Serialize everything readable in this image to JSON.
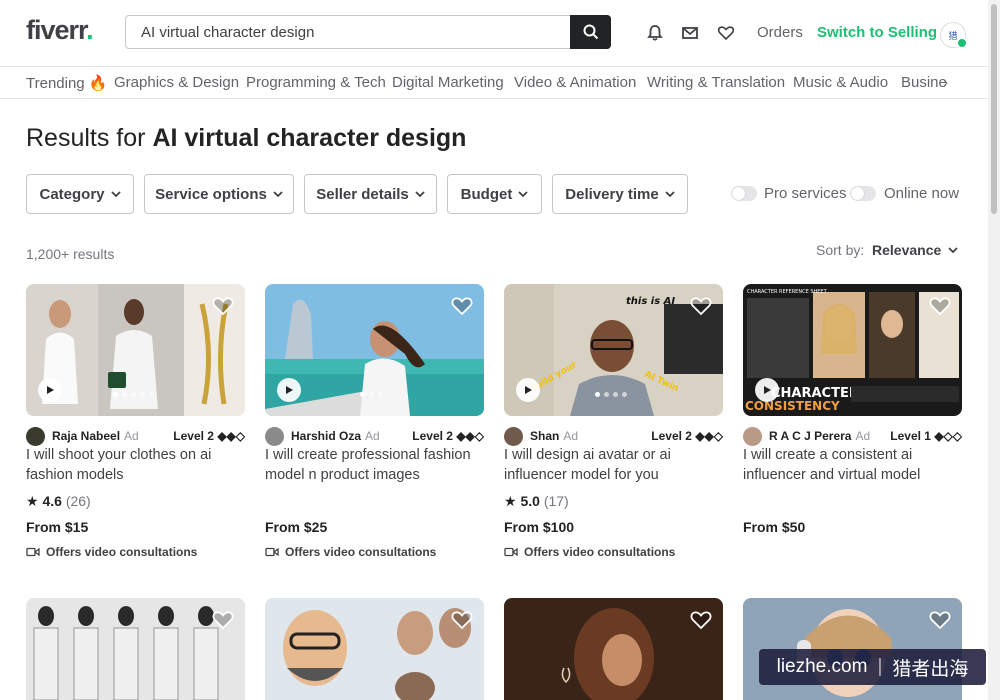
{
  "header": {
    "logo": "fiverr",
    "logo_dot": ".",
    "search_value": "AI virtual character design",
    "orders": "Orders",
    "switch_selling": "Switch to Selling",
    "avatar_text": "猎"
  },
  "categories": [
    "Trending",
    "Graphics & Design",
    "Programming & Tech",
    "Digital Marketing",
    "Video & Animation",
    "Writing & Translation",
    "Music & Audio",
    "Busine"
  ],
  "trending_emoji": "🔥",
  "results": {
    "title_prefix": "Results for ",
    "query": "AI virtual character design",
    "count": "1,200+ results",
    "sort_label": "Sort by:",
    "sort_value": "Relevance"
  },
  "filters": [
    "Category",
    "Service options",
    "Seller details",
    "Budget",
    "Delivery time"
  ],
  "toggles": [
    "Pro services",
    "Online now"
  ],
  "gigs": [
    {
      "seller": "Raja Nabeel",
      "ad": "Ad",
      "level": "Level 2",
      "level_diamonds": "◆◆◇",
      "title": "I will shoot your clothes on ai fashion models",
      "rating": "4.6",
      "reviews": "(26)",
      "price": "From $15",
      "video": "Offers video consultations"
    },
    {
      "seller": "Harshid Oza",
      "ad": "Ad",
      "level": "Level 2",
      "level_diamonds": "◆◆◇",
      "title": "I will create professional fashion model n product images",
      "rating": "",
      "reviews": "",
      "price": "From $25",
      "video": "Offers video consultations"
    },
    {
      "seller": "Shan",
      "ad": "Ad",
      "level": "Level 2",
      "level_diamonds": "◆◆◇",
      "title": "I will design ai avatar or ai influencer model for you",
      "rating": "5.0",
      "reviews": "(17)",
      "price": "From $100",
      "video": "Offers video consultations"
    },
    {
      "seller": "R A C J Perera",
      "ad": "Ad",
      "level": "Level 1",
      "level_diamonds": "◆◇◇",
      "title": "I will create a consistent ai influencer and virtual model",
      "rating": "",
      "reviews": "",
      "price": "From $50",
      "video": ""
    }
  ],
  "image_texts": {
    "card3_overlay": "this is AI",
    "card3_build": "Build your",
    "card3_twin": "AI Twin",
    "card4_sheet": "CHARACTER REFERENCE SHEET",
    "card4_big1": "CHARACTER",
    "card4_big2": "CONSISTENCY"
  },
  "watermark": {
    "left": "liezhe.com",
    "right": "猎者出海"
  },
  "colors": {
    "brand_green": "#1dbf73",
    "text": "#404145"
  }
}
